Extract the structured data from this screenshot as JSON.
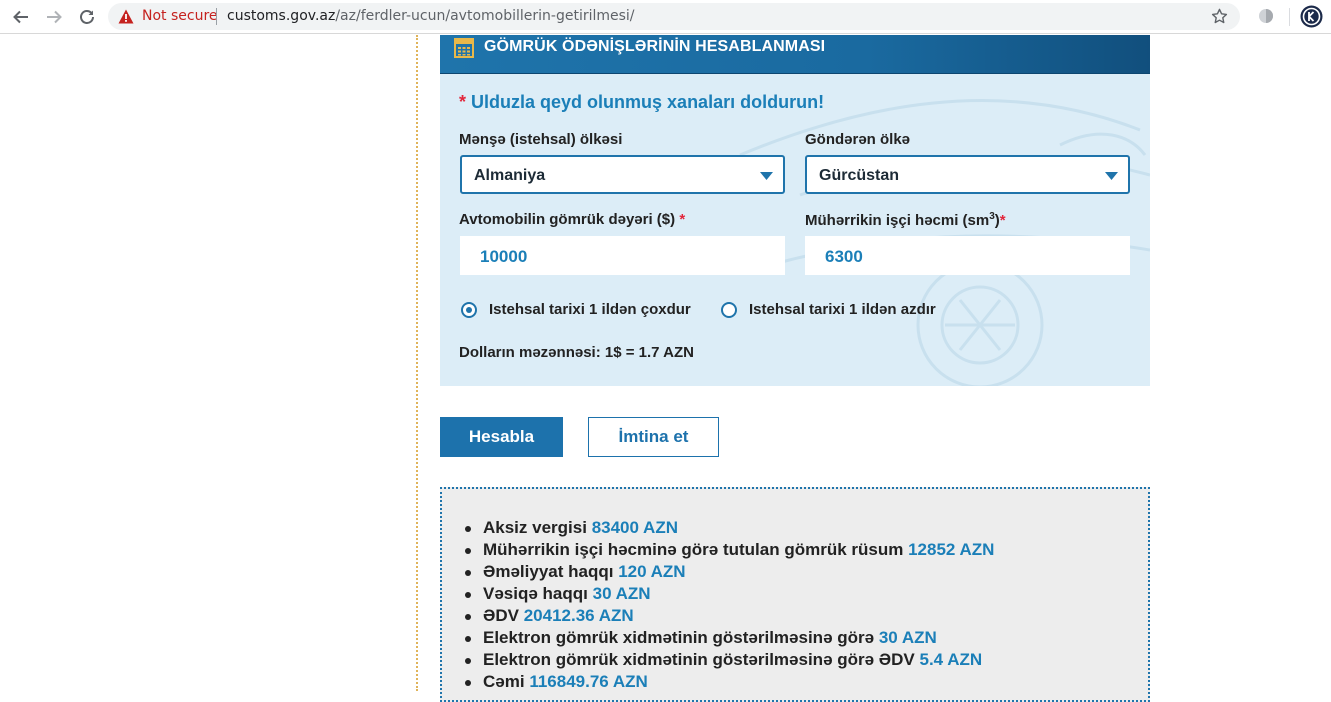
{
  "browser": {
    "not_secure": "Not secure",
    "url_host": "customs.gov.az",
    "url_path": "/az/ferdler-ucun/avtomobillerin-getirilmesi/"
  },
  "calculator": {
    "title": "GÖMRÜK ÖDƏNİŞLƏRİNİN HESABLANMASI",
    "required_star": "*",
    "required_note": "Ulduzla qeyd olunmuş xanaları doldurun!",
    "origin_label": "Mənşə (istehsal) ölkəsi",
    "origin_value": "Almaniya",
    "sender_label": "Göndərən ölkə",
    "sender_value": "Gürcüstan",
    "value_label": "Avtomobilin gömrük dəyəri ($)",
    "value_input": "10000",
    "engine_label": "Mühərrikin işçi həcmi (sm",
    "engine_label_sup": "3",
    "engine_label_end": ")",
    "engine_input": "6300",
    "radio_more": "Istehsal tarixi 1 ildən çoxdur",
    "radio_more_checked": true,
    "radio_less": "Istehsal tarixi 1 ildən azdır",
    "rate": "Dolların məzənnəsi: 1$ = 1.7 AZN"
  },
  "buttons": {
    "calculate": "Hesabla",
    "cancel": "İmtina et"
  },
  "results": [
    {
      "label": "Aksiz vergisi",
      "amount": "83400 AZN"
    },
    {
      "label": "Mühərrikin işçi həcminə görə tutulan gömrük rüsum",
      "amount": "12852 AZN"
    },
    {
      "label": "Əməliyyat haqqı",
      "amount": "120 AZN"
    },
    {
      "label": "Vəsiqə haqqı",
      "amount": "30 AZN"
    },
    {
      "label": "ƏDV",
      "amount": "20412.36 AZN"
    },
    {
      "label": "Elektron gömrük xidmətinin göstərilməsinə görə",
      "amount": "30 AZN"
    },
    {
      "label": "Elektron gömrük xidmətinin göstərilməsinə görə ƏDV",
      "amount": "5.4 AZN"
    },
    {
      "label": "Cəmi",
      "amount": "116849.76 AZN"
    }
  ],
  "colors": {
    "accent": "#1d72ac",
    "value_blue": "#1b7fb8",
    "required_red": "#e2263b",
    "panel_bg": "#dcedf7"
  }
}
